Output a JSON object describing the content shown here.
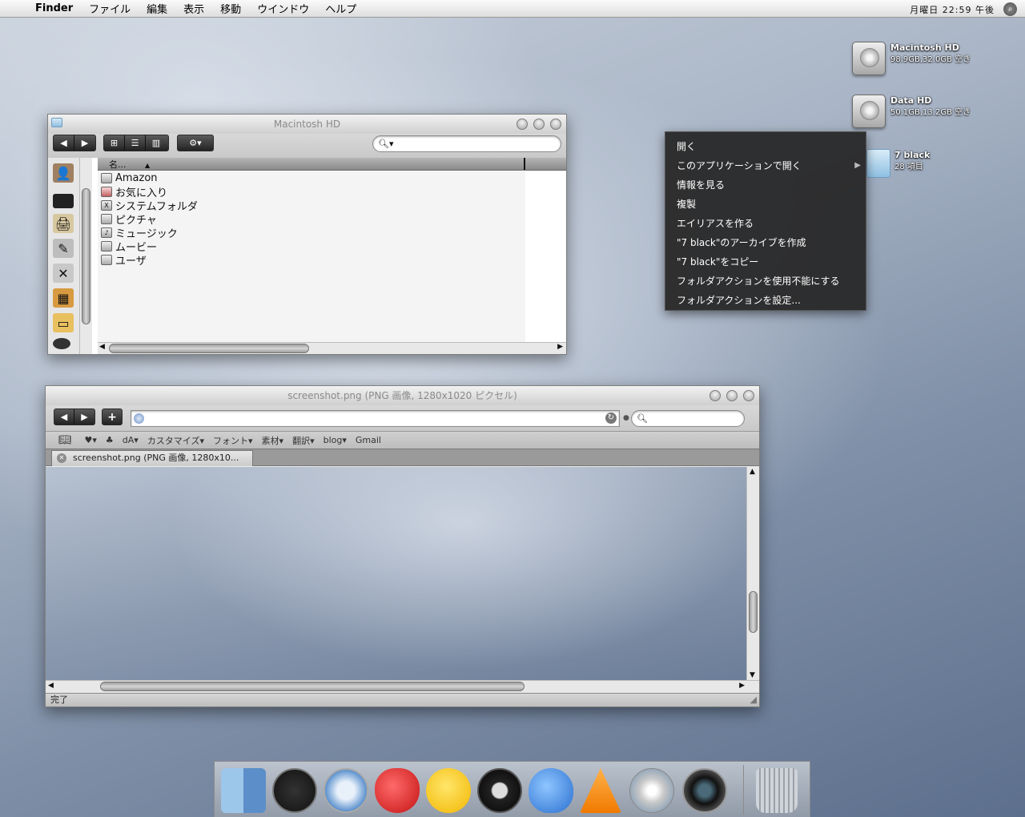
{
  "menubar": {
    "app": "Finder",
    "items": [
      "ファイル",
      "編集",
      "表示",
      "移動",
      "ウインドウ",
      "ヘルプ"
    ],
    "clock": "月曜日 22:59 午後"
  },
  "desktop": {
    "icons": [
      {
        "name": "Macintosh HD",
        "sub": "98.9GB,32.0GB 空き"
      },
      {
        "name": "Data HD",
        "sub": "50.1GB,13.2GB 空き"
      },
      {
        "name": "7 black",
        "sub": "28 項目"
      }
    ]
  },
  "finder": {
    "title": "Macintosh HD",
    "column_header": "名...",
    "rows": [
      "Amazon",
      "お気に入り",
      "システムフォルダ",
      "ピクチャ",
      "ミュージック",
      "ムービー",
      "ユーザ"
    ]
  },
  "context_menu": {
    "items": [
      "開く",
      "このアプリケーションで開く",
      "情報を見る",
      "複製",
      "エイリアスを作る",
      "\"7 black\"のアーカイブを作成",
      "\"7 black\"をコピー",
      "フォルダアクションを使用不能にする",
      "フォルダアクションを設定..."
    ]
  },
  "browser": {
    "title": "screenshot.png (PNG 画像, 1280x1020 ピクセル)",
    "bookmarks": [
      "♥▾",
      "♣",
      "dA▾",
      "カスタマイズ▾",
      "フォント▾",
      "素材▾",
      "翻訳▾",
      "blog▾",
      "Gmail"
    ],
    "tab": "screenshot.png (PNG 画像, 1280x10...",
    "status": "完了"
  },
  "dock": {
    "items": [
      "Finder",
      "Dashboard",
      "Safari",
      "Strawberry",
      "Duck",
      "BitTorrent",
      "Slime",
      "VLC",
      "iTunes",
      "Camera",
      "Trash"
    ]
  }
}
